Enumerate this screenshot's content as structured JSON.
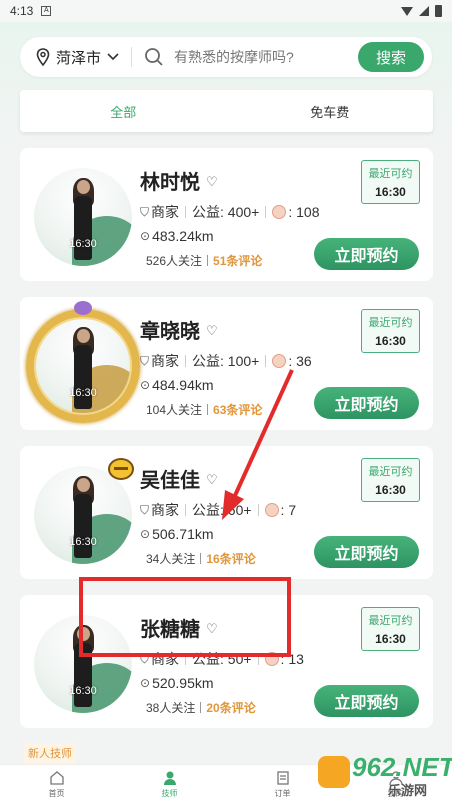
{
  "status_bar": {
    "time": "4:13",
    "notif": "A"
  },
  "search": {
    "location": "菏泽市",
    "placeholder": "有熟悉的按摩师吗?",
    "button": "搜索"
  },
  "tabs": [
    {
      "label": "全部",
      "active": true
    },
    {
      "label": "免车费",
      "active": false
    }
  ],
  "cards": [
    {
      "name": "林时悦",
      "merchant": "商家",
      "charity": "公益: 400+",
      "flowers": ": 108",
      "distance": "483.24km",
      "followers": "526人关注",
      "reviews": "51条评论",
      "recent_label": "最近可约",
      "recent_time": "16:30",
      "avatar_time": "16:30",
      "book": "立即预约",
      "frame": "none"
    },
    {
      "name": "章晓晓",
      "merchant": "商家",
      "charity": "公益: 100+",
      "flowers": ": 36",
      "distance": "484.94km",
      "followers": "104人关注",
      "reviews": "63条评论",
      "recent_label": "最近可约",
      "recent_time": "16:30",
      "avatar_time": "16:30",
      "book": "立即预约",
      "frame": "gold"
    },
    {
      "name": "吴佳佳",
      "merchant": "商家",
      "charity": "公益: 60+",
      "flowers": ": 7",
      "distance": "506.71km",
      "followers": "34人关注",
      "reviews": "16条评论",
      "recent_label": "最近可约",
      "recent_time": "16:30",
      "avatar_time": "16:30",
      "book": "立即预约",
      "frame": "bee"
    },
    {
      "name": "张糖糖",
      "merchant": "商家",
      "charity": "公益: 50+",
      "flowers": ": 13",
      "distance": "520.95km",
      "followers": "38人关注",
      "reviews": "20条评论",
      "recent_label": "最近可约",
      "recent_time": "16:30",
      "avatar_time": "16:30",
      "book": "立即预约",
      "frame": "none"
    }
  ],
  "new_tech_label": "新人技师",
  "nav": [
    {
      "label": "首页",
      "icon": "home-icon"
    },
    {
      "label": "技师",
      "icon": "technician-icon",
      "active": true
    },
    {
      "label": "订单",
      "icon": "order-icon"
    },
    {
      "label": "我的",
      "icon": "profile-icon"
    }
  ],
  "watermark": {
    "main": "962.NET",
    "sub": "乐游网"
  },
  "colors": {
    "accent": "#3aa76d",
    "review": "#e0963a",
    "annotation": "#e32b2b"
  }
}
